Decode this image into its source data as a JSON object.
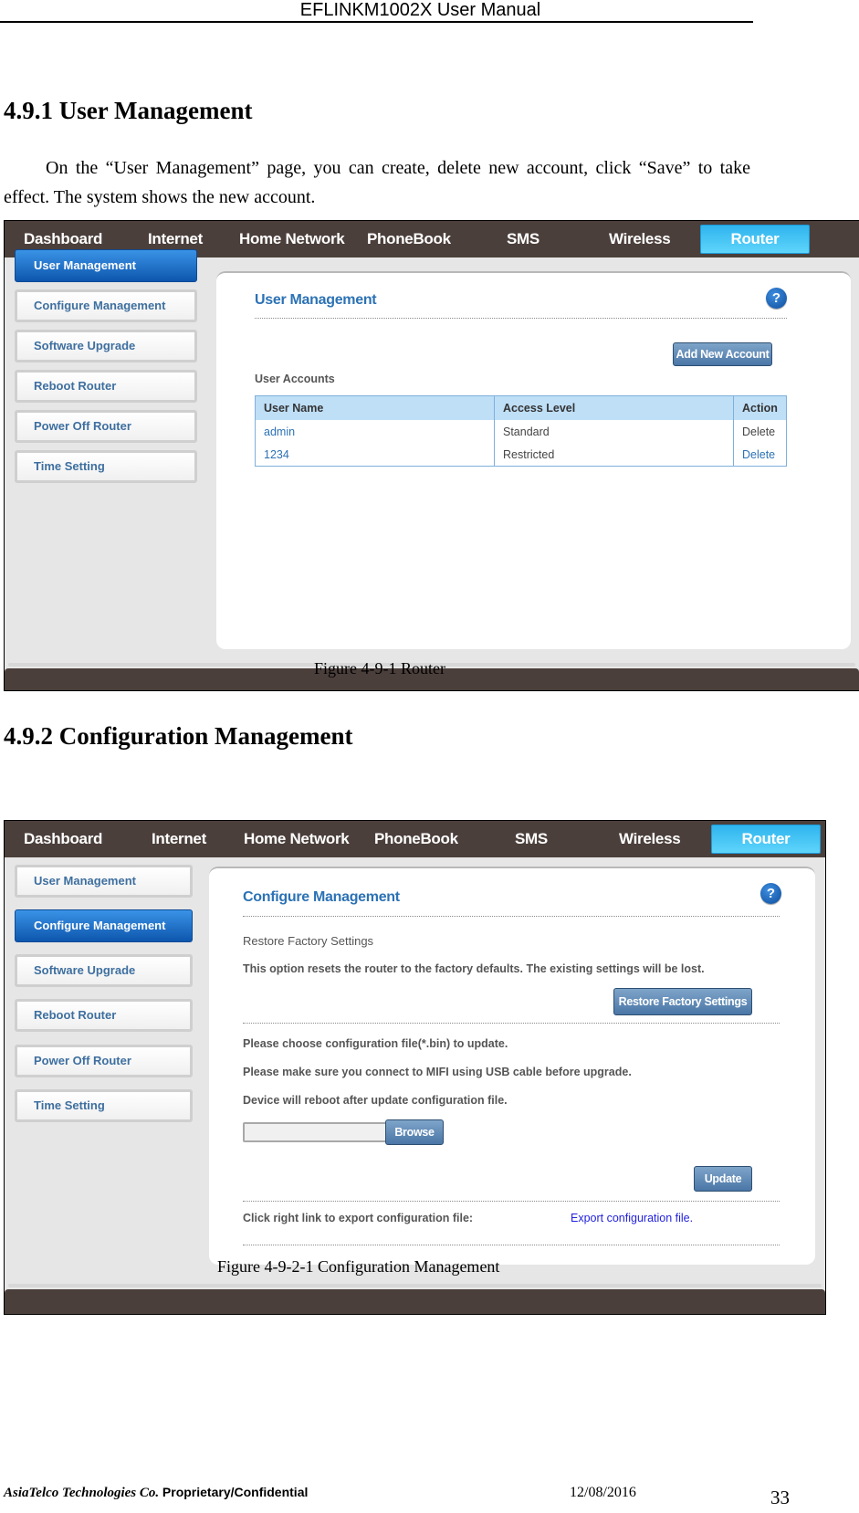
{
  "document": {
    "header_title": "EFLINKM1002X User Manual",
    "section_1": {
      "heading": "4.9.1 User Management",
      "intro": "On the “User Management” page, you can create, delete new account, click “Save” to take effect. The system shows the new account.",
      "caption": "Figure 4-9-1 Router"
    },
    "section_2": {
      "heading": "4.9.2 Configuration Management",
      "caption": "Figure 4-9-2-1 Configuration Management"
    },
    "footer": {
      "company": "AsiaTelco Technologies Co.",
      "confidential": "Proprietary/Confidential",
      "date": "12/08/2016",
      "page_number": "33"
    }
  },
  "router_ui": {
    "nav_tabs": [
      "Dashboard",
      "Internet",
      "Home Network",
      "PhoneBook",
      "SMS",
      "Wireless",
      "Router"
    ],
    "active_tab": "Router",
    "sidebar_items": [
      "User Management",
      "Configure Management",
      "Software Upgrade",
      "Reboot Router",
      "Power Off Router",
      "Time Setting"
    ],
    "help_icon_glyph": "?",
    "colors": {
      "nav_background": "#4b3f3b",
      "active_tab": "#3cc0f2",
      "active_sidebar": "#1b6cc4",
      "title_blue": "#2c72b5",
      "button_blue": "#5a84b2",
      "table_header": "#bfdff7",
      "link_blue": "#2222dd"
    }
  },
  "figure_1": {
    "active_sidebar": "User Management",
    "title": "User Management",
    "add_button": "Add New Account",
    "accounts_label": "User Accounts",
    "table": {
      "headers": [
        "User Name",
        "Access Level",
        "Action"
      ],
      "rows": [
        {
          "user_name": "admin",
          "access_level": "Standard",
          "action": "Delete",
          "action_enabled": false
        },
        {
          "user_name": "1234",
          "access_level": "Restricted",
          "action": "Delete",
          "action_enabled": true
        }
      ]
    }
  },
  "figure_2": {
    "active_sidebar": "Configure Management",
    "title": "Configure Management",
    "restore_heading": "Restore Factory Settings",
    "restore_description": "This option resets the router to the factory defaults. The existing settings will be lost.",
    "restore_button": "Restore Factory Settings",
    "update_line_1": "Please choose configuration file(*.bin) to update.",
    "update_line_2": "Please make sure you connect to MIFI using USB cable before upgrade.",
    "update_line_3": "Device will reboot after update configuration file.",
    "file_input_value": "",
    "browse_button": "Browse",
    "update_button": "Update",
    "export_label": "Click right link to export configuration file:",
    "export_link": "Export configuration file."
  }
}
